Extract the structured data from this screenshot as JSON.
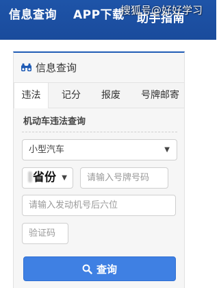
{
  "topnav": {
    "items": [
      "信息查询",
      "APP下载",
      "助手指南"
    ]
  },
  "watermark": "搜狐号@好好学习",
  "panel": {
    "title": "信息查询",
    "icon": "binoculars-icon",
    "tabs": [
      "违法",
      "记分",
      "报废",
      "号牌邮寄"
    ],
    "active_tab": 0,
    "section_title": "机动车违法查询",
    "vehicle_type": "小型汽车",
    "province": "省份",
    "plate_placeholder": "请输入号牌号码",
    "engine_placeholder": "请输入发动机号后六位",
    "captcha_placeholder": "验证码",
    "search_label": "查询"
  },
  "colors": {
    "nav_bg": "#1e54a8",
    "accent": "#1f5bb5",
    "button": "#3f80e3"
  }
}
